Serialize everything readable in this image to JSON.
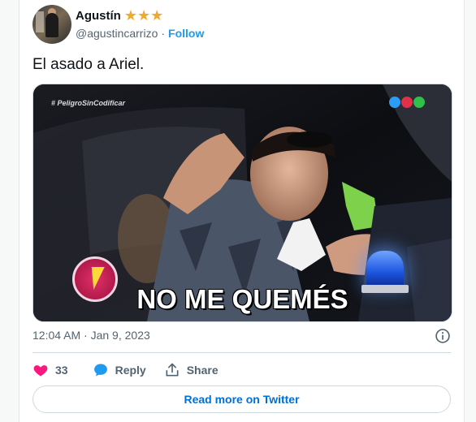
{
  "author": {
    "name": "Agustín",
    "stars": "★★★",
    "handle": "@agustincarrizo",
    "separator": "·",
    "follow_label": "Follow"
  },
  "tweet": {
    "text": "El asado a Ariel.",
    "timestamp": "12:04 AM · Jan 9, 2023"
  },
  "media": {
    "hashtag": "# PeligroSinCodificar",
    "caption": "NO ME QUEMÉS",
    "logo_colors": [
      "#2a9df4",
      "#e0304a",
      "#2fbf4a"
    ]
  },
  "actions": {
    "like_count": "33",
    "reply_label": "Reply",
    "share_label": "Share"
  },
  "read_more_label": "Read more on Twitter",
  "colors": {
    "accent": "#1d9bf0",
    "like": "#f91880",
    "muted": "#536471",
    "border": "#cfd9de"
  }
}
